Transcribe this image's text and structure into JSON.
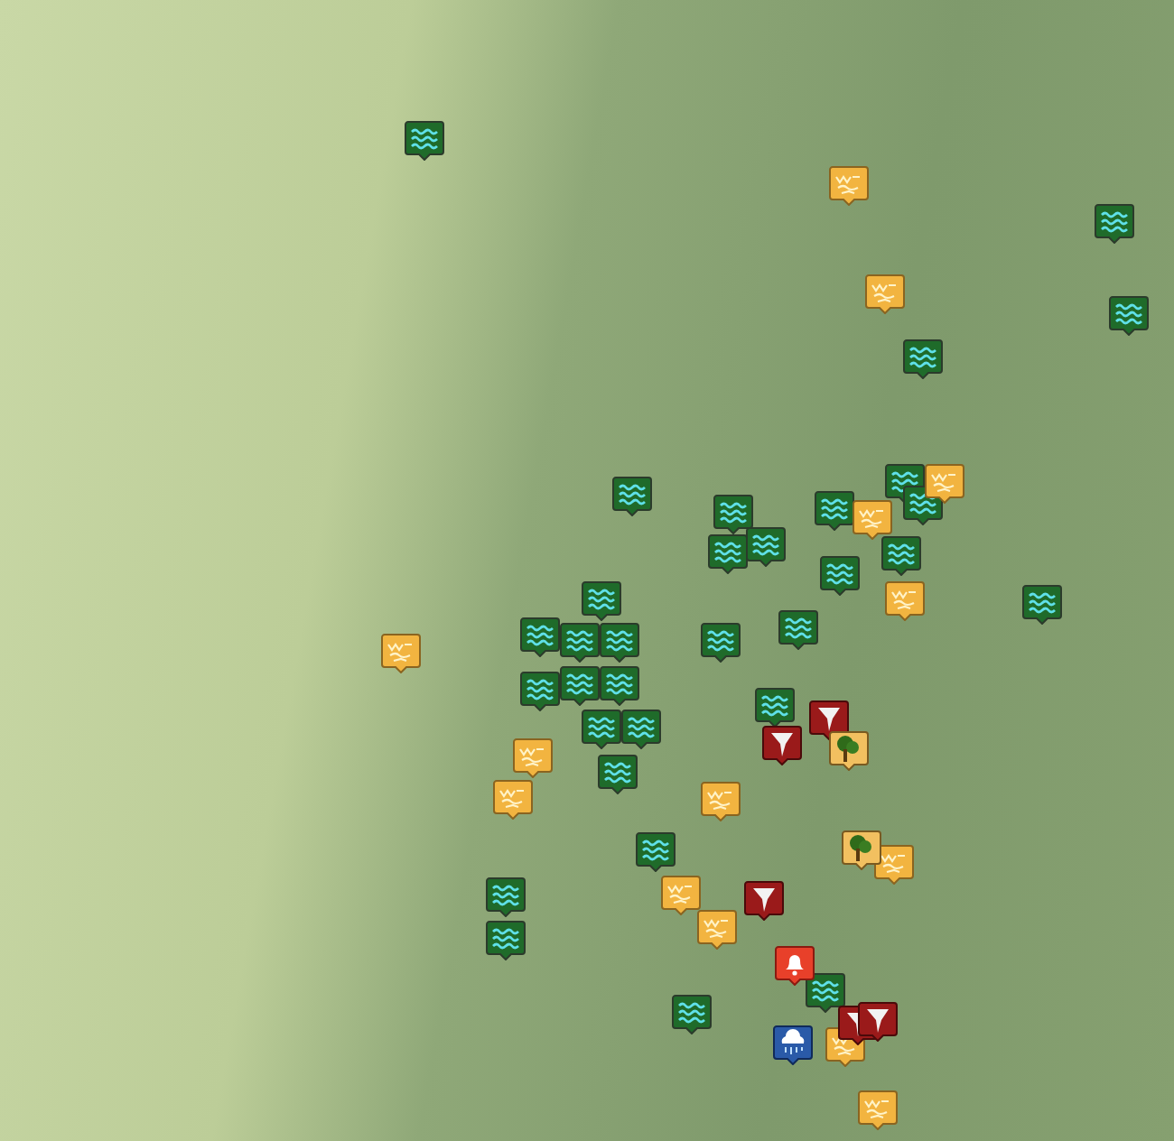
{
  "map": {
    "markers": [
      {
        "kind": "flood"
      },
      {
        "kind": "flood"
      },
      {
        "kind": "flood"
      },
      {
        "kind": "flood"
      },
      {
        "kind": "flood"
      },
      {
        "kind": "flood"
      },
      {
        "kind": "flood"
      },
      {
        "kind": "flood"
      },
      {
        "kind": "flood"
      },
      {
        "kind": "flood"
      },
      {
        "kind": "flood"
      },
      {
        "kind": "flood"
      },
      {
        "kind": "flood"
      },
      {
        "kind": "flood"
      },
      {
        "kind": "flood"
      },
      {
        "kind": "flood"
      },
      {
        "kind": "flood"
      },
      {
        "kind": "flood"
      },
      {
        "kind": "flood"
      },
      {
        "kind": "flood"
      },
      {
        "kind": "flood"
      },
      {
        "kind": "flood"
      },
      {
        "kind": "flood"
      },
      {
        "kind": "flood"
      },
      {
        "kind": "flood"
      },
      {
        "kind": "flood"
      },
      {
        "kind": "flood"
      },
      {
        "kind": "flood"
      },
      {
        "kind": "flood"
      },
      {
        "kind": "flood"
      },
      {
        "kind": "flood"
      },
      {
        "kind": "flood"
      },
      {
        "kind": "statement"
      },
      {
        "kind": "statement"
      },
      {
        "kind": "statement"
      },
      {
        "kind": "statement"
      },
      {
        "kind": "statement"
      },
      {
        "kind": "statement"
      },
      {
        "kind": "statement"
      },
      {
        "kind": "statement"
      },
      {
        "kind": "statement"
      },
      {
        "kind": "statement"
      },
      {
        "kind": "statement"
      },
      {
        "kind": "statement"
      },
      {
        "kind": "statement"
      },
      {
        "kind": "statement"
      },
      {
        "kind": "tornado"
      },
      {
        "kind": "tornado"
      },
      {
        "kind": "tornado"
      },
      {
        "kind": "tornado"
      },
      {
        "kind": "tornado"
      },
      {
        "kind": "damage"
      },
      {
        "kind": "damage"
      },
      {
        "kind": "alert"
      },
      {
        "kind": "rain"
      }
    ]
  }
}
